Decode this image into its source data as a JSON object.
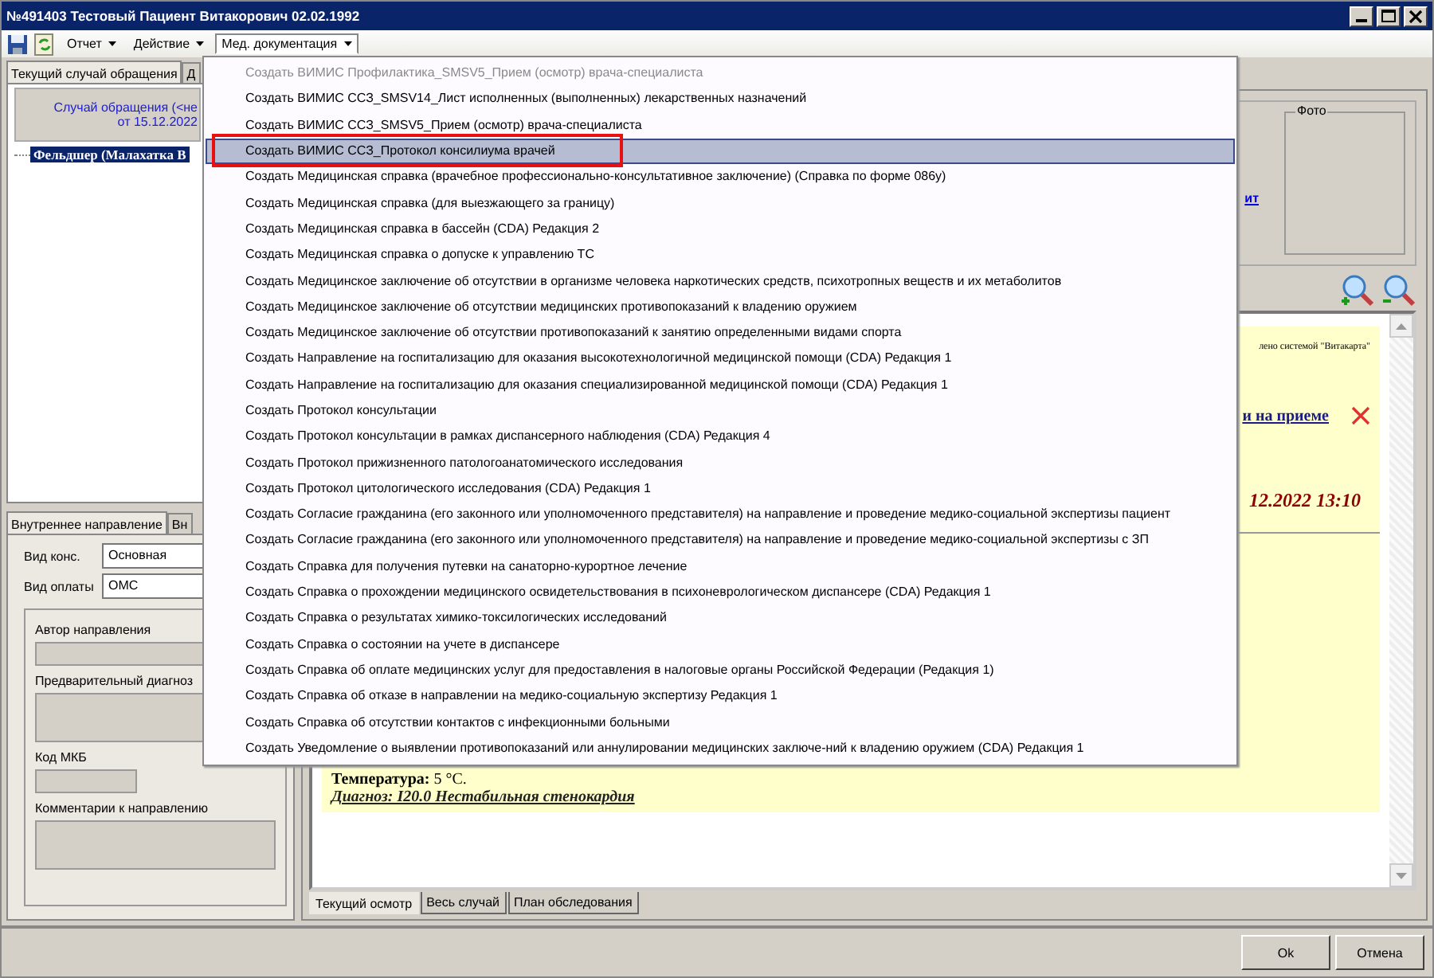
{
  "window": {
    "title": "№491403 Тестовый Пациент Витакорович 02.02.1992"
  },
  "toolbar": {
    "menus": [
      {
        "label": "Отчет",
        "selected": false
      },
      {
        "label": "Действие",
        "selected": false
      },
      {
        "label": "Мед. документация",
        "selected": true
      }
    ]
  },
  "left_panel": {
    "tabs": [
      {
        "label": "Текущий случай обращения",
        "selected": true
      },
      {
        "label": "Д",
        "selected": false
      }
    ],
    "case_header": [
      "Случай обращения (<не",
      "от 15.12.2022"
    ],
    "tree": [
      {
        "label": "Фельдшер (Малахатка В",
        "selected": true
      }
    ],
    "referral_tabs": [
      {
        "label": "Внутреннее направление",
        "selected": true
      },
      {
        "label": "Вн",
        "selected": false
      }
    ],
    "fields": [
      {
        "label": "Вид конс.",
        "value": "Основная"
      },
      {
        "label": "Вид оплаты",
        "value": "ОМС"
      }
    ],
    "group_fields": [
      {
        "label": "Автор направления",
        "kind": "line"
      },
      {
        "label": "Предварительный диагноз",
        "kind": "box"
      },
      {
        "label": "Код МКБ",
        "kind": "short"
      },
      {
        "label": "Комментарии к направлению",
        "kind": "box"
      }
    ]
  },
  "right_panel": {
    "photo_label": "Фото",
    "link": "ит",
    "document": {
      "note": "лено системой \"Витакарта\"",
      "link": "и на приеме",
      "datetime": "12.2022 13:10",
      "temperature_label": "Температура:",
      "temperature_value": "5 °С.",
      "diagnosis": "Диагноз: I20.0 Нестабильная стенокардия"
    },
    "bottom_tabs": [
      {
        "label": "Текущий осмотр",
        "selected": true
      },
      {
        "label": "Весь случай",
        "selected": false
      },
      {
        "label": "План обследования",
        "selected": false
      }
    ]
  },
  "menu": {
    "items": [
      {
        "label": "Создать ВИМИС Профилактика_SMSV5_Прием (осмотр) врача-специалиста",
        "disabled": true,
        "selected": false,
        "annotated": false
      },
      {
        "label": "Создать ВИМИС ССЗ_SMSV14_Лист исполненных (выполненных) лекарственных назначений",
        "disabled": false,
        "selected": false,
        "annotated": false
      },
      {
        "label": "Создать ВИМИС ССЗ_SMSV5_Прием (осмотр) врача-специалиста",
        "disabled": false,
        "selected": false,
        "annotated": false
      },
      {
        "label": "Создать ВИМИС ССЗ_Протокол консилиума врачей",
        "disabled": false,
        "selected": true,
        "annotated": true
      },
      {
        "label": "Создать Медицинская справка (врачебное профессионально-консультативное заключение) (Справка по форме 086у)",
        "disabled": false,
        "selected": false,
        "annotated": false
      },
      {
        "label": "Создать Медицинская справка (для выезжающего за границу)",
        "disabled": false,
        "selected": false,
        "annotated": false
      },
      {
        "label": "Создать Медицинская справка в бассейн (CDA) Редакция 2",
        "disabled": false,
        "selected": false,
        "annotated": false
      },
      {
        "label": "Создать Медицинская справка о допуске к управлению ТС",
        "disabled": false,
        "selected": false,
        "annotated": false
      },
      {
        "label": "Создать Медицинское заключение об отсутствии в организме человека наркотических средств, психотропных веществ и их метаболитов",
        "disabled": false,
        "selected": false,
        "annotated": false
      },
      {
        "label": "Создать Медицинское заключение об отсутствии медицинских противопоказаний к владению оружием",
        "disabled": false,
        "selected": false,
        "annotated": false
      },
      {
        "label": "Создать Медицинское заключение об отсутствии противопоказаний к занятию определенными видами спорта",
        "disabled": false,
        "selected": false,
        "annotated": false
      },
      {
        "label": "Создать Направление на госпитализацию для оказания высокотехнологичной медицинской помощи (CDA) Редакция 1",
        "disabled": false,
        "selected": false,
        "annotated": false
      },
      {
        "label": "Создать Направление на госпитализацию для оказания специализированной медицинской помощи (CDA) Редакция 1",
        "disabled": false,
        "selected": false,
        "annotated": false
      },
      {
        "label": "Создать Протокол консультации",
        "disabled": false,
        "selected": false,
        "annotated": false
      },
      {
        "label": "Создать Протокол консультации в рамках диспансерного наблюдения (CDA) Редакция 4",
        "disabled": false,
        "selected": false,
        "annotated": false
      },
      {
        "label": "Создать Протокол прижизненного патологоанатомического исследования",
        "disabled": false,
        "selected": false,
        "annotated": false
      },
      {
        "label": "Создать Протокол цитологического исследования (CDA) Редакция 1",
        "disabled": false,
        "selected": false,
        "annotated": false
      },
      {
        "label": "Создать Согласие гражданина (его законного или уполномоченного представителя) на направление и проведение медико-социальной экспертизы пациент",
        "disabled": false,
        "selected": false,
        "annotated": false
      },
      {
        "label": "Создать Согласие гражданина (его законного или уполномоченного представителя) на направление и проведение медико-социальной экспертизы с ЗП",
        "disabled": false,
        "selected": false,
        "annotated": false
      },
      {
        "label": "Создать Справка для получения путевки на санаторно-курортное лечение",
        "disabled": false,
        "selected": false,
        "annotated": false
      },
      {
        "label": "Создать Справка о прохождении медицинского освидетельствования в психоневрологическом диспансере (CDA) Редакция 1",
        "disabled": false,
        "selected": false,
        "annotated": false
      },
      {
        "label": "Создать Справка о результатах химико-токсилогических исследований",
        "disabled": false,
        "selected": false,
        "annotated": false
      },
      {
        "label": "Создать Справка о состоянии на учете в диспансере",
        "disabled": false,
        "selected": false,
        "annotated": false
      },
      {
        "label": "Создать Справка об оплате медицинских услуг для предоставления в налоговые органы Российской Федерации (Редакция 1)",
        "disabled": false,
        "selected": false,
        "annotated": false
      },
      {
        "label": "Создать Справка об отказе в направлении на медико-социальную экспертизу Редакция 1",
        "disabled": false,
        "selected": false,
        "annotated": false
      },
      {
        "label": "Создать Справка об отсутствии контактов с инфекционными больными",
        "disabled": false,
        "selected": false,
        "annotated": false
      },
      {
        "label": "Создать Уведомление о выявлении противопоказаний или аннулировании медицинских заключе-ний к владению оружием (CDA) Редакция 1",
        "disabled": false,
        "selected": false,
        "annotated": false
      }
    ]
  },
  "buttons": [
    {
      "label": "Ok"
    },
    {
      "label": "Отмена"
    }
  ]
}
